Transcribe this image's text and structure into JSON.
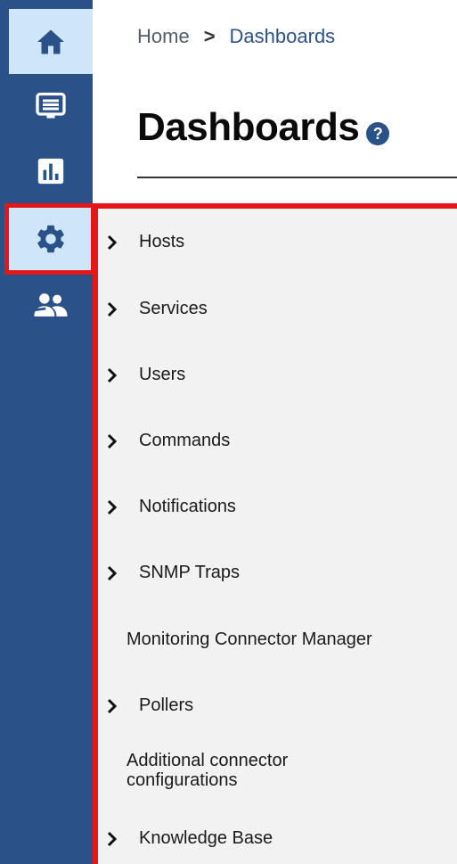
{
  "rail": {
    "items": [
      {
        "name": "home",
        "icon": "home-icon",
        "active": true
      },
      {
        "name": "monitoring",
        "icon": "monitor-list-icon",
        "active": false
      },
      {
        "name": "reporting",
        "icon": "bar-chart-icon",
        "active": false
      },
      {
        "name": "configuration",
        "icon": "gear-icon",
        "active": true
      },
      {
        "name": "administration",
        "icon": "users-icon",
        "active": false
      }
    ]
  },
  "breadcrumb": {
    "home": "Home",
    "separator": ">",
    "current": "Dashboards"
  },
  "page": {
    "title": "Dashboards",
    "help": "?"
  },
  "menu": {
    "items": [
      {
        "label": "Hosts",
        "expandable": true
      },
      {
        "label": "Services",
        "expandable": true
      },
      {
        "label": "Users",
        "expandable": true
      },
      {
        "label": "Commands",
        "expandable": true
      },
      {
        "label": "Notifications",
        "expandable": true
      },
      {
        "label": "SNMP Traps",
        "expandable": true
      },
      {
        "label": "Monitoring Connector Manager",
        "expandable": false
      },
      {
        "label": "Pollers",
        "expandable": true
      },
      {
        "label": "Additional connector configurations",
        "expandable": false
      },
      {
        "label": "Knowledge Base",
        "expandable": true
      }
    ]
  },
  "colors": {
    "rail_bg": "#2b5189",
    "rail_active_bg": "#cfe6fa",
    "highlight": "#e3181d",
    "panel_bg": "#f2f2f2"
  }
}
